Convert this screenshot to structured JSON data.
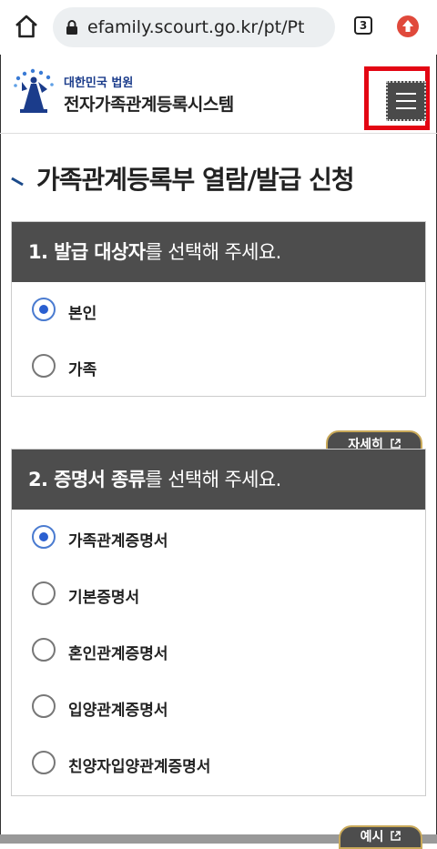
{
  "browser": {
    "url": "efamily.scourt.go.kr/pt/Pt",
    "tab_count": "3"
  },
  "header": {
    "court_name": "대한민국 법원",
    "system_name": "전자가족관계등록시스템"
  },
  "page_title": "가족관계등록부 열람/발급 신청",
  "section1": {
    "heading_bold": "1. 발급 대상자",
    "heading_rest": "를 선택해 주세요.",
    "options": [
      {
        "label": "본인",
        "checked": true
      },
      {
        "label": "가족",
        "checked": false
      }
    ]
  },
  "detail_button": "자세히",
  "section2": {
    "heading_bold": "2. 증명서 종류",
    "heading_rest": "를 선택해 주세요.",
    "options": [
      {
        "label": "가족관계증명서",
        "checked": true
      },
      {
        "label": "기본증명서",
        "checked": false
      },
      {
        "label": "혼인관계증명서",
        "checked": false
      },
      {
        "label": "입양관계증명서",
        "checked": false
      },
      {
        "label": "친양자입양관계증명서",
        "checked": false
      }
    ]
  },
  "example_button": "예시",
  "colors": {
    "highlight": "#e30613",
    "section_header": "#4d4d4d",
    "radio_accent": "#2a5fd0",
    "brand_blue": "#1b3c8b"
  }
}
